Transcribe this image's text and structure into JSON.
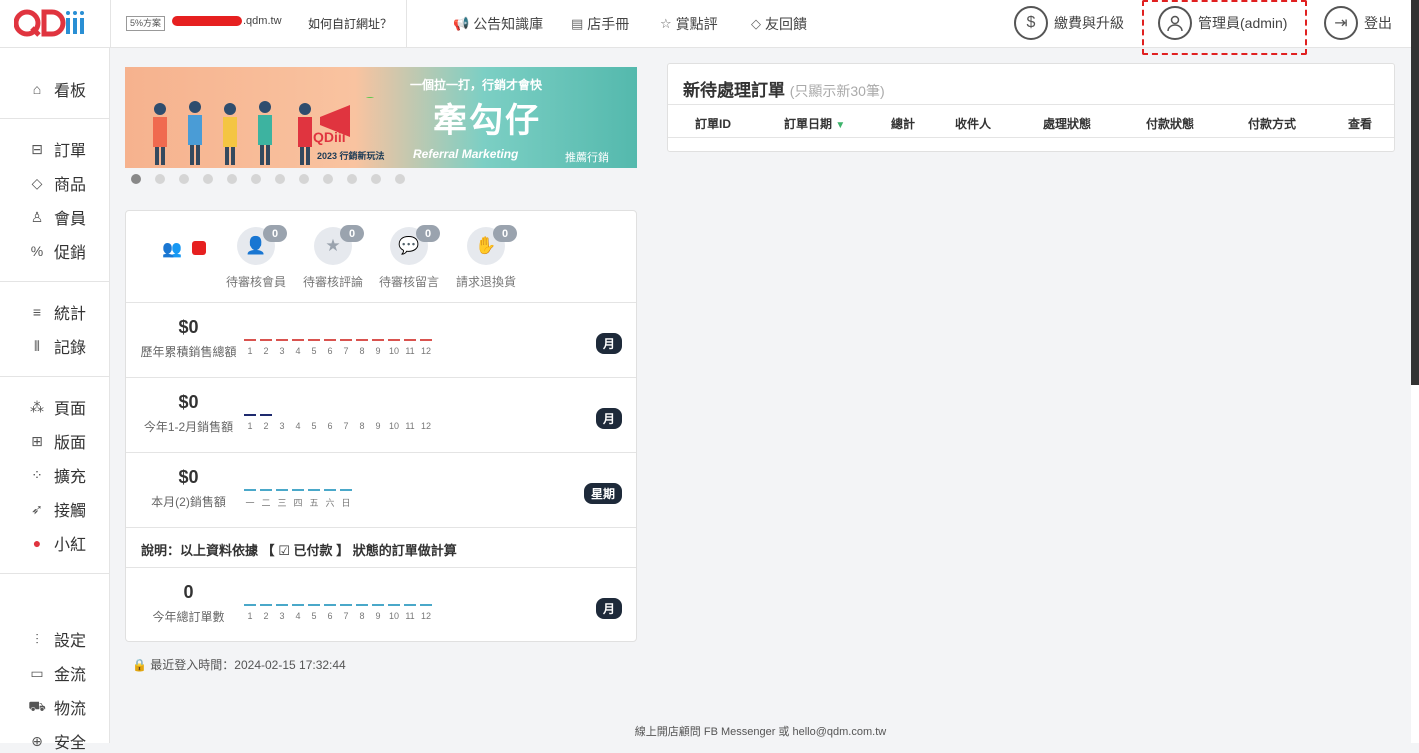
{
  "brand": {
    "logo_text": "QDiii",
    "plan_badge": "5%方案",
    "domain_suffix": ".qdm.tw",
    "howto": "如何自訂網址？"
  },
  "topnav": [
    {
      "icon": "megaphone-icon",
      "glyph": "📢",
      "label": "公告知識庫"
    },
    {
      "icon": "book-icon",
      "glyph": "▤",
      "label": "店手冊"
    },
    {
      "icon": "star-icon",
      "glyph": "☆",
      "label": "賞點評"
    },
    {
      "icon": "diamond-icon",
      "glyph": "◇",
      "label": "友回饋"
    }
  ],
  "account": {
    "pay_label": "繳費與升級",
    "admin_label": "管理員(admin)",
    "logout_label": "登出"
  },
  "sidebar": {
    "items": [
      {
        "name": "dashboard",
        "icon": "home-icon",
        "glyph": "⌂",
        "label": "看板"
      },
      {
        "name": "orders",
        "icon": "inbox-icon",
        "glyph": "⊟",
        "label": "訂單"
      },
      {
        "name": "products",
        "icon": "tag-icon",
        "glyph": "◇",
        "label": "商品"
      },
      {
        "name": "members",
        "icon": "user-icon",
        "glyph": "♙",
        "label": "會員"
      },
      {
        "name": "promotions",
        "icon": "percent-icon",
        "glyph": "%",
        "label": "促銷"
      },
      {
        "name": "stats",
        "icon": "bars-icon",
        "glyph": "≡",
        "label": "統計"
      },
      {
        "name": "records",
        "icon": "candle-icon",
        "glyph": "⫴",
        "label": "記錄"
      },
      {
        "name": "pages",
        "icon": "sitemap-icon",
        "glyph": "⁂",
        "label": "頁面"
      },
      {
        "name": "layouts",
        "icon": "layout-icon",
        "glyph": "⊞",
        "label": "版面"
      },
      {
        "name": "extensions",
        "icon": "plus-grid-icon",
        "glyph": "⁘",
        "label": "擴充"
      },
      {
        "name": "touch",
        "icon": "plane-icon",
        "glyph": "➶",
        "label": "接觸"
      },
      {
        "name": "xiaohong",
        "icon": "red-badge-icon",
        "glyph": "●",
        "label": "小紅"
      },
      {
        "name": "settings",
        "icon": "sliders-icon",
        "glyph": "⫶",
        "label": "設定"
      },
      {
        "name": "payments",
        "icon": "card-icon",
        "glyph": "▭",
        "label": "金流"
      },
      {
        "name": "logistics",
        "icon": "truck-icon",
        "glyph": "⛟",
        "label": "物流"
      },
      {
        "name": "security",
        "icon": "shield-icon",
        "glyph": "⊕",
        "label": "安全"
      }
    ]
  },
  "banner": {
    "slogan": "一個拉一打，行銷才會快",
    "title": "牽勾仔",
    "subtitle": "Referral Marketing",
    "tag": "推薦行銷",
    "year": "2023 行銷新玩法",
    "logo": "QDiii"
  },
  "pending": [
    {
      "icon": "user-plus-icon",
      "glyph": "👤",
      "count": "0",
      "label": "待審核會員"
    },
    {
      "icon": "star-review-icon",
      "glyph": "★",
      "count": "0",
      "label": "待審核評論"
    },
    {
      "icon": "comment-icon",
      "glyph": "💬",
      "count": "0",
      "label": "待審核留言"
    },
    {
      "icon": "hand-icon",
      "glyph": "✋",
      "count": "0",
      "label": "請求退換貨"
    }
  ],
  "stats": [
    {
      "amount": "$0",
      "caption": "歷年累積銷售總額",
      "period": "月",
      "color": "#d9534f",
      "ticks": [
        "1",
        "2",
        "3",
        "4",
        "5",
        "6",
        "7",
        "8",
        "9",
        "10",
        "11",
        "12"
      ],
      "bars": 12
    },
    {
      "amount": "$0",
      "caption": "今年1-2月銷售額",
      "period": "月",
      "color": "#1e2a6e",
      "ticks": [
        "1",
        "2",
        "3",
        "4",
        "5",
        "6",
        "7",
        "8",
        "9",
        "10",
        "11",
        "12"
      ],
      "bars": 2
    },
    {
      "amount": "$0",
      "caption": "本月(2)銷售額",
      "period": "星期",
      "color": "#4aa8c9",
      "ticks": [
        "一",
        "二",
        "三",
        "四",
        "五",
        "六",
        "日"
      ],
      "bars": 7
    }
  ],
  "note": "說明：以上資料依據 【 ☑ 已付款 】 狀態的訂單做計算",
  "order_count": {
    "amount": "0",
    "caption": "今年總訂單數",
    "period": "月",
    "color": "#4aa8c9",
    "ticks": [
      "1",
      "2",
      "3",
      "4",
      "5",
      "6",
      "7",
      "8",
      "9",
      "10",
      "11",
      "12"
    ],
    "bars": 12
  },
  "last_login": "最近登入時間：2024-02-15 17:32:44",
  "orders_panel": {
    "title": "新待處理訂單",
    "hint": "(只顯示新30筆)",
    "columns": [
      "訂單ID",
      "訂單日期",
      "總計",
      "收件人",
      "處理狀態",
      "付款狀態",
      "付款方式",
      "查看"
    ]
  },
  "footer": {
    "line1": "線上開店顧問 FB Messenger 或 hello@qdm.com.tw"
  }
}
